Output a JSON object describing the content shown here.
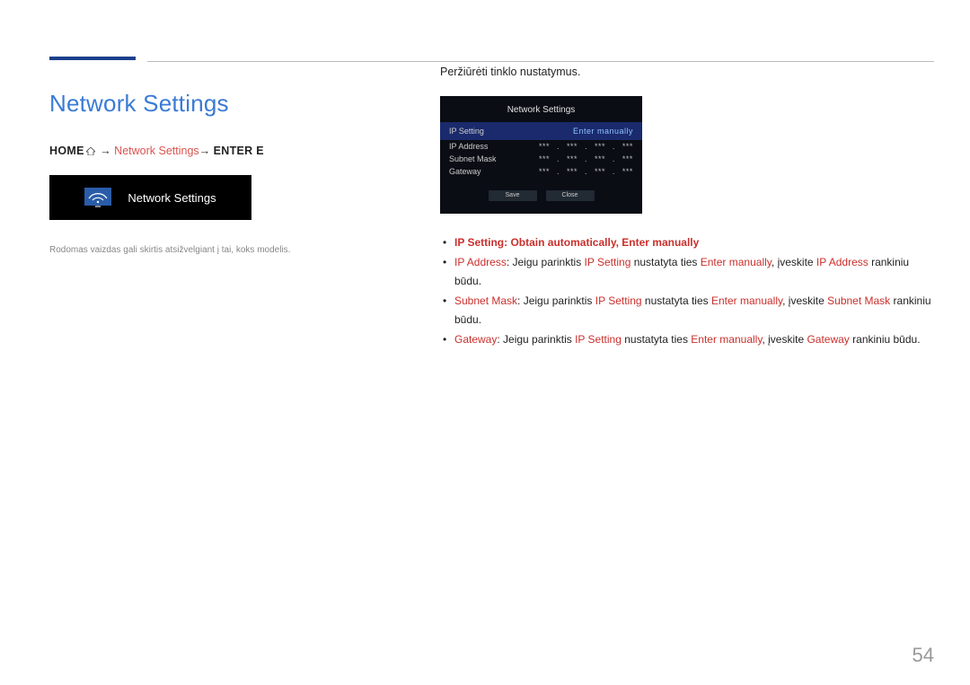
{
  "page": {
    "title": "Network Settings",
    "page_number": "54"
  },
  "breadcrumb": {
    "home": "HOME",
    "arrow": "→",
    "mid": "Network Settings",
    "end": "ENTER E"
  },
  "widget": {
    "label": "Network Settings"
  },
  "disclaimer": "Rodomas vaizdas gali skirtis atsižvelgiant į tai, koks modelis.",
  "right": {
    "intro": "Peržiūrėti tinklo nustatymus."
  },
  "panel": {
    "title": "Network Settings",
    "ip_setting_label": "IP Setting",
    "ip_setting_value": "Enter manually",
    "rows": [
      {
        "label": "IP Address",
        "v1": "***",
        "v2": "***",
        "v3": "***",
        "v4": "***"
      },
      {
        "label": "Subnet Mask",
        "v1": "***",
        "v2": "***",
        "v3": "***",
        "v4": "***"
      },
      {
        "label": "Gateway",
        "v1": "***",
        "v2": "***",
        "v3": "***",
        "v4": "***"
      }
    ],
    "save": "Save",
    "close": "Close"
  },
  "bullets": {
    "b1": {
      "label": "IP Setting",
      "sep": ": ",
      "v1": "Obtain automatically",
      "comma": ", ",
      "v2": "Enter manually"
    },
    "b2": {
      "label": "IP Address",
      "t1": ": Jeigu parinktis ",
      "ipset": "IP Setting",
      "t2": " nustatyta ties ",
      "enter": "Enter manually",
      "t3": ", įveskite ",
      "field": "IP Address",
      "t4": " rankiniu būdu."
    },
    "b3": {
      "label": "Subnet Mask",
      "t1": ": Jeigu parinktis ",
      "ipset": "IP Setting",
      "t2": " nustatyta ties ",
      "enter": "Enter manually",
      "t3": ", įveskite ",
      "field": "Subnet Mask",
      "t4": " rankiniu būdu."
    },
    "b4": {
      "label": "Gateway",
      "t1": ": Jeigu parinktis ",
      "ipset": "IP Setting",
      "t2": " nustatyta ties ",
      "enter": "Enter manually",
      "t3": ", įveskite ",
      "field": "Gateway",
      "t4": " rankiniu būdu."
    }
  }
}
